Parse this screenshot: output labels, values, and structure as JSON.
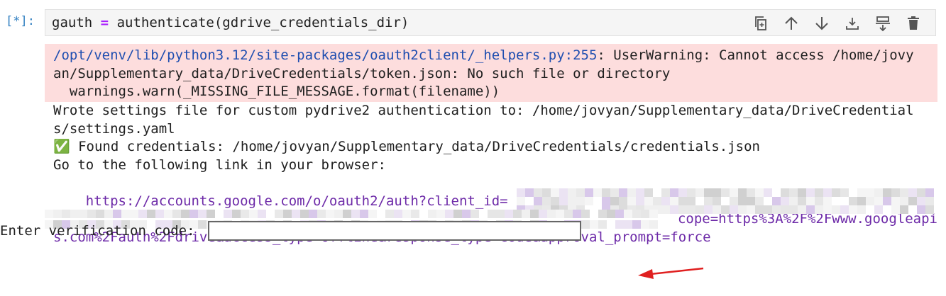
{
  "cell": {
    "prompt": "[*]:",
    "code_var": "gauth",
    "code_op": "=",
    "code_call": "authenticate(gdrive_credentials_dir)"
  },
  "toolbar": {
    "items": [
      {
        "name": "duplicate-cell-button",
        "icon": "copy-icon"
      },
      {
        "name": "move-cell-up-button",
        "icon": "arrow-up-icon"
      },
      {
        "name": "move-cell-down-button",
        "icon": "arrow-down-icon"
      },
      {
        "name": "insert-cell-above-button",
        "icon": "insert-above-icon"
      },
      {
        "name": "insert-cell-below-button",
        "icon": "insert-below-icon"
      },
      {
        "name": "delete-cell-button",
        "icon": "trash-icon"
      }
    ]
  },
  "stderr": {
    "path": "/opt/venv/lib/python3.12/site-packages/oauth2client/_helpers.py:255",
    "line1_rest": ": UserWarning: Cannot access /home/jovy",
    "line2": "an/Supplementary_data/DriveCredentials/token.json: No such file or directory",
    "line3": "  warnings.warn(_MISSING_FILE_MESSAGE.format(filename))"
  },
  "stdout": {
    "line1": "Wrote settings file for custom pydrive2 authentication to: /home/jovyan/Supplementary_data/DriveCredential",
    "line2": "s/settings.yaml",
    "line3": "✅ Found credentials: /home/jovyan/Supplementary_data/DriveCredentials/credentials.json",
    "line4": "Go to the following link in your browser:",
    "link_part1": "    https://accounts.google.com/o/oauth2/auth?client_id=",
    "link_part2": "cope=https%3A%2F%2Fwww.googleapi",
    "link_part3": "s.com%2Fauth%2Fdrive&access_type=offline&response_type=code&approval_prompt=force"
  },
  "verify": {
    "label": "Enter verification code:",
    "value": ""
  },
  "colors": {
    "prompt": "#307fc1",
    "stderr_bg": "#fddddd",
    "link": "#6d2aa8",
    "arrow": "#e02020"
  }
}
